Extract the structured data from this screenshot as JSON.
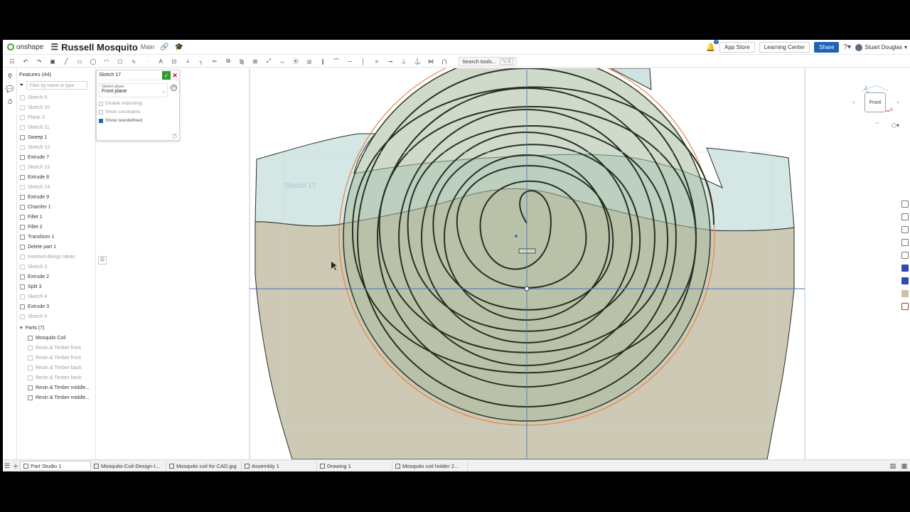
{
  "app": {
    "brand": "onshape",
    "document_title": "Russell Mosquito",
    "branch": "Main"
  },
  "topbar": {
    "notification_count": "7",
    "app_store": "App Store",
    "learning_center": "Learning Center",
    "share": "Share",
    "user_name": "Stuart Douglas"
  },
  "toolbar": {
    "search_placeholder": "Search tools...",
    "search_shortcut": "⌥ C"
  },
  "feature_tree": {
    "title": "Features (44)",
    "filter_placeholder": "Filter by name or type",
    "features": [
      {
        "label": "Sketch 6",
        "dim": true
      },
      {
        "label": "Sketch 10",
        "dim": true
      },
      {
        "label": "Plane 3",
        "dim": true
      },
      {
        "label": "Sketch 11",
        "dim": true
      },
      {
        "label": "Sweep 1",
        "dim": false
      },
      {
        "label": "Sketch 12",
        "dim": true
      },
      {
        "label": "Extrude 7",
        "dim": false
      },
      {
        "label": "Sketch 13",
        "dim": true
      },
      {
        "label": "Extrude 8",
        "dim": false
      },
      {
        "label": "Sketch 14",
        "dim": true
      },
      {
        "label": "Extrude 9",
        "dim": false
      },
      {
        "label": "Chamfer 1",
        "dim": false
      },
      {
        "label": "Fillet 1",
        "dim": false
      },
      {
        "label": "Fillet 2",
        "dim": false
      },
      {
        "label": "Transform 1",
        "dim": false
      },
      {
        "label": "Delete part 1",
        "dim": false
      },
      {
        "label": "Inserted design ideas",
        "dim": true
      },
      {
        "label": "Sketch 3",
        "dim": true
      },
      {
        "label": "Extrude 2",
        "dim": false
      },
      {
        "label": "Split 3",
        "dim": false
      },
      {
        "label": "Sketch 4",
        "dim": true
      },
      {
        "label": "Extrude 3",
        "dim": false
      },
      {
        "label": "Sketch 5",
        "dim": true
      }
    ],
    "parts_title": "Parts (7)",
    "parts": [
      {
        "label": "Mosquito Coil",
        "dim": false
      },
      {
        "label": "Resin & Timber front",
        "dim": true
      },
      {
        "label": "Resin & Timber front",
        "dim": true
      },
      {
        "label": "Resin & Timber back",
        "dim": true
      },
      {
        "label": "Resin & Timber back",
        "dim": true
      },
      {
        "label": "Resin & Timber middle...",
        "dim": false
      },
      {
        "label": "Resin & Timber middle...",
        "dim": false
      }
    ]
  },
  "sketch_dialog": {
    "title": "Sketch 17",
    "plane_label": "Sketch plane",
    "plane_value": "Front plane",
    "options": [
      {
        "label": "Disable imprinting",
        "checked": false
      },
      {
        "label": "Show constraints",
        "checked": false
      },
      {
        "label": "Show overdefined",
        "checked": true
      }
    ]
  },
  "viewport": {
    "sketch_label": "Sketch 17",
    "view_cube_face": "Front",
    "axis_z": "Z",
    "axis_x": "X"
  },
  "tabs": [
    {
      "label": "Part Studio 1",
      "active": true
    },
    {
      "label": "Mosquito-Coil-Design-I...",
      "active": false
    },
    {
      "label": "Mosquito coil for CAD.jpg",
      "active": false
    },
    {
      "label": "Assembly 1",
      "active": false
    },
    {
      "label": "Drawing 1",
      "active": false
    },
    {
      "label": "Mosquito coil holder 2...",
      "active": false
    }
  ],
  "colors": {
    "share_blue": "#2062b5",
    "coil_green": "#a9bfa0",
    "sketch_orange": "#e8834a",
    "holder_tan": "#cfcab5",
    "resin_cyan": "#cfe6e6"
  }
}
